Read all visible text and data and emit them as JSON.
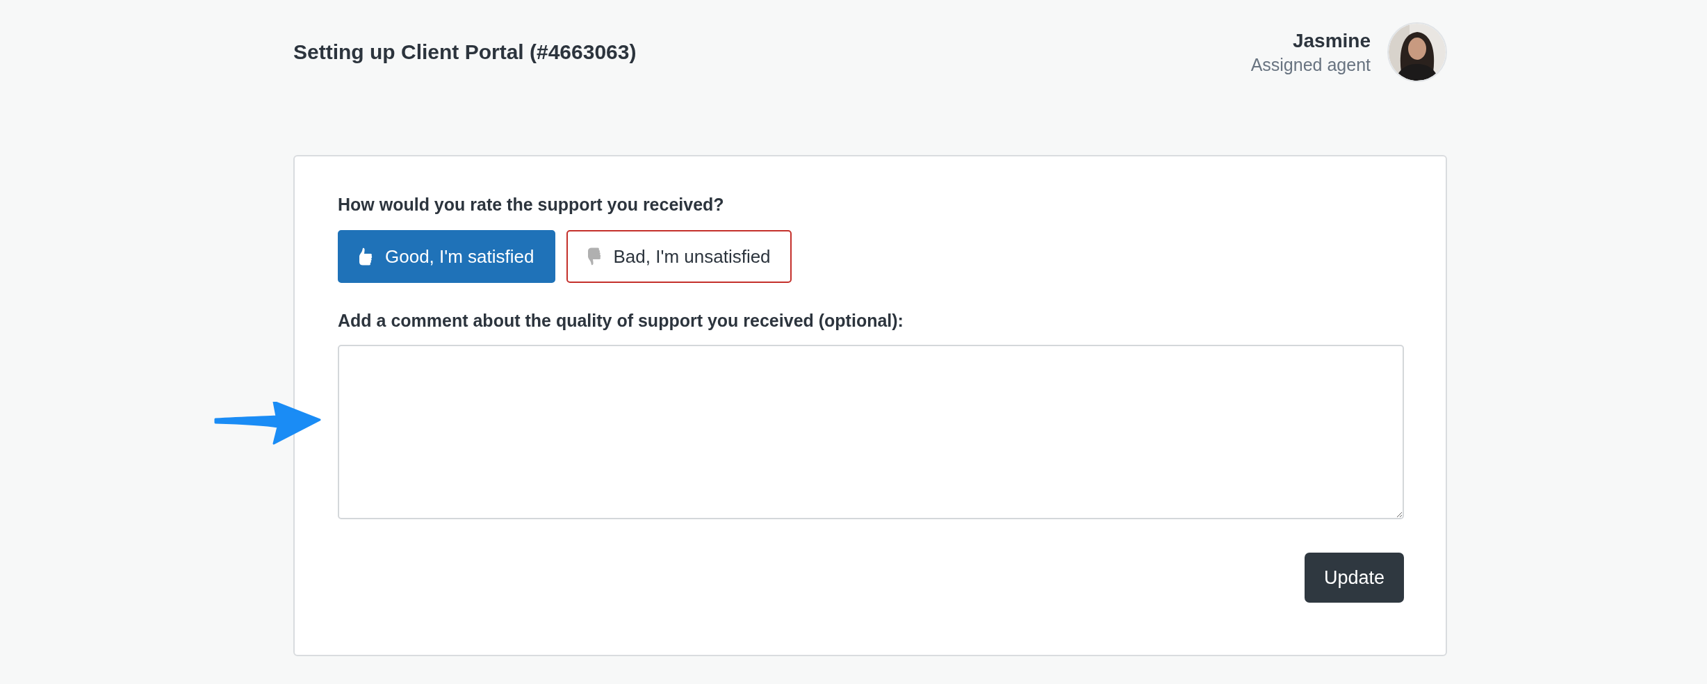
{
  "header": {
    "title": "Setting up Client Portal (#4663063)",
    "agent_name": "Jasmine",
    "agent_role": "Assigned agent"
  },
  "rating": {
    "question": "How would you rate the support you received?",
    "options": [
      {
        "kind": "good",
        "label": "Good, I'm satisfied",
        "selected": true
      },
      {
        "kind": "bad",
        "label": "Bad, I'm unsatisfied",
        "selected": false
      }
    ]
  },
  "comment": {
    "label": "Add a comment about the quality of support you received (optional):"
  },
  "submit": "Update"
}
